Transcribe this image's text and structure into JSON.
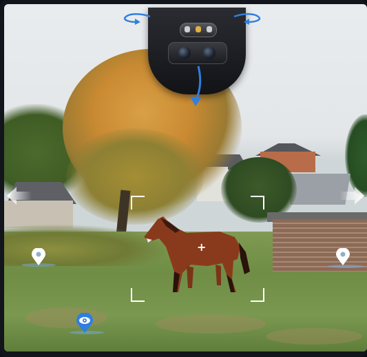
{
  "scene": {
    "subject": "horse-icon",
    "camera": "ptz-camera-icon"
  },
  "controls": {
    "pan_left": "rotate-left-arrow-icon",
    "pan_right": "rotate-right-arrow-icon",
    "tilt_down": "tilt-down-arrow-icon",
    "move_left": "arrow-left-icon",
    "move_right": "arrow-right-icon"
  },
  "markers": {
    "preset_left": "location-pin-icon",
    "preset_right": "location-pin-icon",
    "current_view": "eye-pin-icon"
  },
  "colors": {
    "accent": "#2f7fe0",
    "frame": "#ffffff",
    "marker": "#ffffff"
  }
}
